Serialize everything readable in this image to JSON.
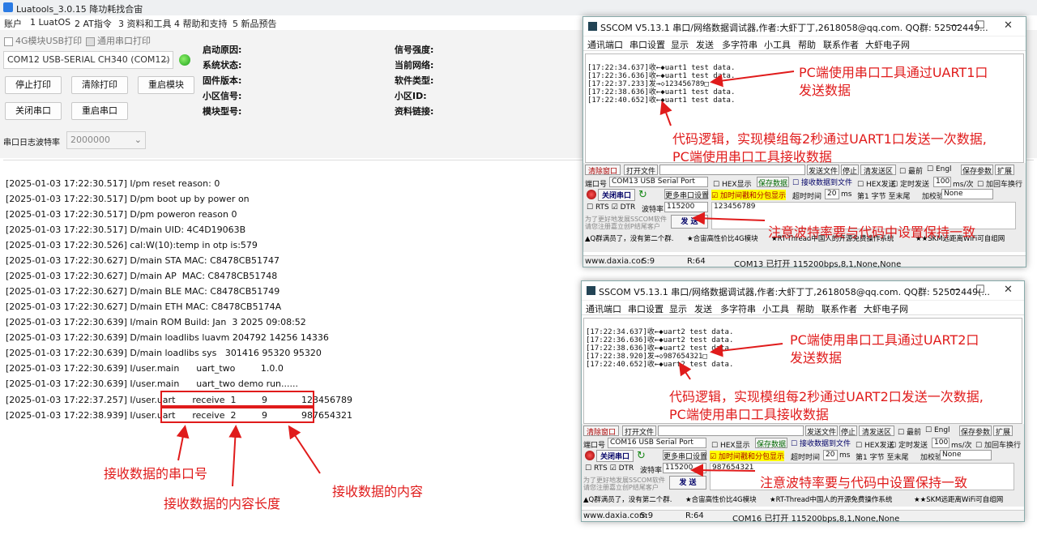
{
  "app": {
    "title": "Luatools_3.0.15 降功耗找合宙",
    "menu": [
      "账户",
      "1 LuatOS",
      "2 AT指令",
      "3 资料和工具",
      "4 帮助和支持",
      "5 新品预告"
    ],
    "check_4g": "4G模块USB打印",
    "check_uart": "通用串口打印",
    "port_select": "COM12 USB-SERIAL CH340 (COM12)",
    "buttons": {
      "stop_print": "停止打印",
      "clear_print": "清除打印",
      "restart_module": "重启模块",
      "close_port": "关闭串口",
      "restart_port": "重启串口"
    },
    "info_labels": [
      "启动原因:",
      "系统状态:",
      "固件版本:",
      "小区信号:",
      "模块型号:"
    ],
    "info_labels2": [
      "信号强度:",
      "当前网络:",
      "软件类型:",
      "小区ID:",
      "资料链接:"
    ],
    "baud_label": "串口日志波特率",
    "baud_value": "2000000"
  },
  "log": [
    "[2025-01-03 17:22:30.517] I/pm reset reason: 0",
    "[2025-01-03 17:22:30.517] D/pm boot up by power on",
    "[2025-01-03 17:22:30.517] D/pm poweron reason 0",
    "[2025-01-03 17:22:30.517] D/main UID: 4C4D19063B",
    "[2025-01-03 17:22:30.526] cal:W(10):temp in otp is:579",
    "[2025-01-03 17:22:30.627] D/main STA MAC: C8478CB51747",
    "[2025-01-03 17:22:30.627] D/main AP  MAC: C8478CB51748",
    "[2025-01-03 17:22:30.627] D/main BLE MAC: C8478CB51749",
    "[2025-01-03 17:22:30.627] D/main ETH MAC: C8478CB5174A",
    "[2025-01-03 17:22:30.639] I/main ROM Build: Jan  3 2025 09:08:52",
    "[2025-01-03 17:22:30.639] D/main loadlibs luavm 204792 14256 14336",
    "[2025-01-03 17:22:30.639] D/main loadlibs sys   301416 95320 95320",
    "[2025-01-03 17:22:30.639] I/user.main      uart_two         1.0.0",
    "[2025-01-03 17:22:30.639] I/user.main      uart_two demo run......",
    "[2025-01-03 17:22:37.257] I/user.uart      receive  1         9            123456789",
    "[2025-01-03 17:22:38.939] I/user.uart      receive  2         9            987654321"
  ],
  "annotations": {
    "port_no": "接收数据的串口号",
    "length": "接收数据的内容长度",
    "content": "接收数据的内容",
    "uart1_send": [
      "PC端使用串口工具通过UART1口",
      "发送数据"
    ],
    "uart1_logic": [
      "代码逻辑，实现模组每2秒通过UART1口发送一次数据,",
      "PC端使用串口工具接收数据"
    ],
    "baud_note": "注意波特率要与代码中设置保持一致",
    "uart2_send": [
      "PC端使用串口工具通过UART2口",
      "发送数据"
    ],
    "uart2_logic": [
      "代码逻辑，实现模组每2秒通过UART2口发送一次数据,",
      "PC端使用串口工具接收数据"
    ]
  },
  "sscom1": {
    "title": "SSCOM V5.13.1 串口/网络数据调试器,作者:大虾丁丁,2618058@qq.com. QQ群: 52502449...",
    "menu": [
      "通讯端口",
      "串口设置",
      "显示",
      "发送",
      "多字符串",
      "小工具",
      "帮助",
      "联系作者",
      "大虾电子网"
    ],
    "lines": [
      "[17:22:34.637]收←◆uart1 test data.",
      "[17:22:36.636]收←◆uart1 test data.",
      "[17:22:37.233]发→◇123456789□",
      "[17:22:38.636]收←◆uart1 test data.",
      "[17:22:40.652]收←◆uart1 test data."
    ],
    "port": "COM13 USB Serial Port",
    "baud": "115200",
    "send_text": "123456789",
    "open_btn": "关闭串口",
    "status": [
      "www.daxia.cor",
      "S:9",
      "R:64",
      "COM13 已打开  115200bps,8,1,None,None"
    ]
  },
  "sscom2": {
    "title": "SSCOM V5.13.1 串口/网络数据调试器,作者:大虾丁丁,2618058@qq.com. QQ群: 52502449(...",
    "menu": [
      "通讯端口",
      "串口设置",
      "显示",
      "发送",
      "多字符串",
      "小工具",
      "帮助",
      "联系作者",
      "大虾电子网"
    ],
    "lines": [
      "[17:22:34.637]收←◆uart2 test data.",
      "[17:22:36.636]收←◆uart2 test data.",
      "[17:22:38.636]收←◆uart2 test data.",
      "[17:22:38.920]发→◇987654321□",
      "[17:22:40.652]收←◆uart2 test data."
    ],
    "port": "COM16 USB Serial Port",
    "baud": "115200",
    "send_text": "987654321",
    "open_btn": "关闭串口",
    "status": [
      "www.daxia.com",
      "S:9",
      "R:64",
      "COM16 已打开  115200bps,8,1,None,None"
    ]
  },
  "sscom_common": {
    "clear_window": "清除窗口",
    "open_file": "打开文件",
    "send_file": "发送文件",
    "stop": "停止",
    "clear_send": "清发送区",
    "topmost": "最前",
    "english": "Engl",
    "save_params": "保存参数",
    "expand": "扩展",
    "port_label": "端口号",
    "hex_show": "HEX显示",
    "save_data": "保存数据",
    "recv_to_file": "接收数据到文件",
    "hex_send": "HEX发送",
    "timed_send": "定时发送",
    "interval": "100",
    "interval_unit": "ms/次",
    "add_crlf": "加回车换行",
    "more_settings": "更多串口设置",
    "timestamp": "加时间戳和分包显示",
    "timeout_label": "超时时间",
    "timeout": "20",
    "ms": "ms",
    "byte_label": "第1",
    "byte_unit": "字节",
    "to_end": "至末尾",
    "checksum": "加校验",
    "checksum_val": "None",
    "rts": "RTS",
    "dtr": "DTR",
    "baud_label": "波特率",
    "send_btn": "发 送",
    "promo": [
      "为了更好地发展SSCOM软件",
      "请您注册嘉立创P结尾客户"
    ],
    "ads": [
      "▲Q群满员了，没有第二个群.",
      "★合宙高性价比4G模块",
      "★RT-Thread中国人的开源免费操作系统",
      "★★SKM远距离WiFi可自组网"
    ]
  }
}
